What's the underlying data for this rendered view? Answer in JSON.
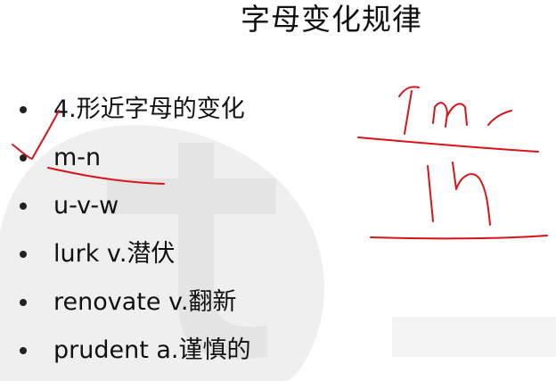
{
  "slide": {
    "title": "字母变化规律",
    "bullets": [
      "4.形近字母的变化",
      "m-n",
      "u-v-w",
      "lurk v.潜伏",
      "renovate v.翻新",
      "prudent a.谨慎的"
    ]
  },
  "colors": {
    "background": "#ffffff",
    "text": "#111111",
    "ink": "#d7141a",
    "watermark": "#e8e8e8"
  }
}
